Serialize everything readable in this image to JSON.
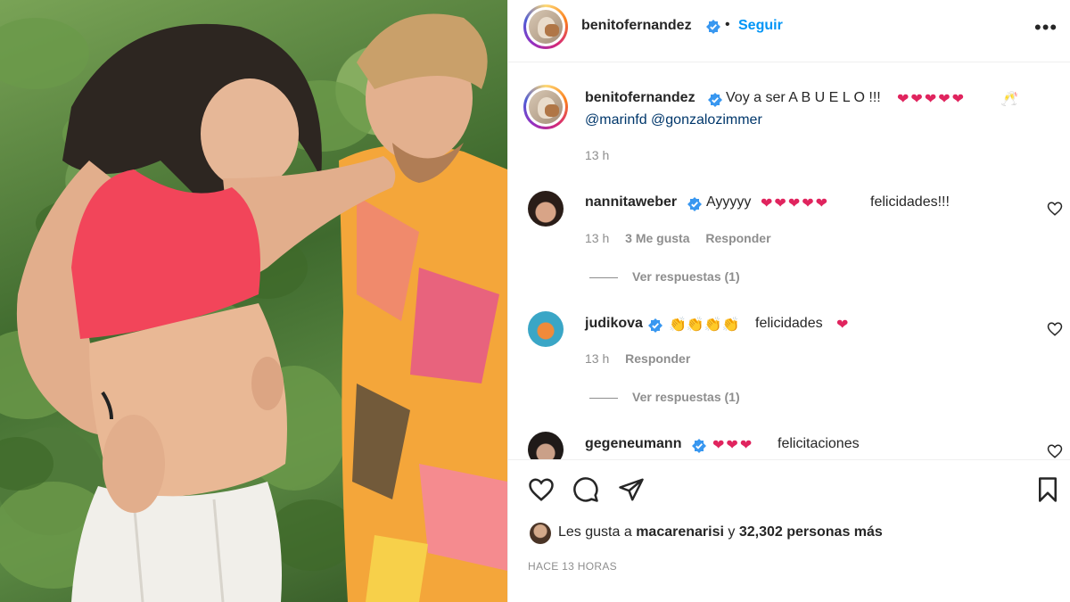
{
  "post": {
    "author": "benitofernandez",
    "follow_label": "Seguir",
    "separator": "•",
    "more_label": "•••"
  },
  "caption": {
    "username": "benitofernandez",
    "text": "Voy a ser A B U E L O !!!",
    "hearts": "❤❤❤❤❤",
    "emoji_end": "🥂",
    "mentions": "@marinfd @gonzalozimmer",
    "time": "13 h"
  },
  "comments": [
    {
      "username": "nannitaweber",
      "text_before": "Ayyyyy",
      "hearts": "❤❤❤❤❤",
      "text_after": "felicidades!!!",
      "time": "13 h",
      "likes": "3 Me gusta",
      "reply_label": "Responder",
      "view_replies": "Ver respuestas (1)"
    },
    {
      "username": "judikova",
      "emojis": "👏👏👏👏",
      "text_after": "felicidades",
      "hearts": "❤",
      "time": "13 h",
      "reply_label": "Responder",
      "view_replies": "Ver respuestas (1)"
    },
    {
      "username": "gegeneumann",
      "hearts": "❤❤❤",
      "text_after": "felicitaciones"
    }
  ],
  "actions": {
    "likes_prefix": "Les gusta a",
    "likes_user": "macarenarisi",
    "likes_connector": "y",
    "likes_count": "32,302 personas más",
    "time_ago": "HACE 13 HORAS"
  },
  "icons": {
    "like": "heart-outline-icon",
    "comment": "comment-bubble-icon",
    "share": "paper-plane-icon",
    "save": "bookmark-icon",
    "verified": "verified-badge-icon",
    "more": "more-options-icon"
  },
  "colors": {
    "link": "#0095f6",
    "mention": "#00376b",
    "muted": "#8e8e8e",
    "heart": "#e0245e",
    "verified": "#3897f0"
  }
}
